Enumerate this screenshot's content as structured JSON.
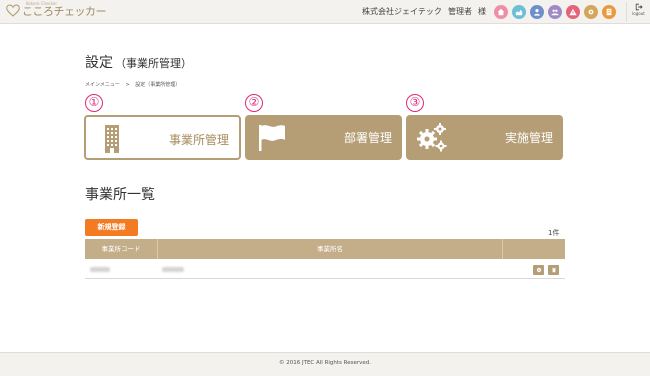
{
  "header": {
    "app_name": "こころチェッカー",
    "app_subtitle": "Kokoro Checker",
    "company": "株式会社ジェイテック",
    "user": "管理者",
    "honorific": "様",
    "nav_icons": [
      {
        "name": "home-icon",
        "color": "#ef8fa6"
      },
      {
        "name": "chart-icon",
        "color": "#6cbfd6"
      },
      {
        "name": "user-icon",
        "color": "#6e8fc9"
      },
      {
        "name": "group-icon",
        "color": "#a089c4"
      },
      {
        "name": "warning-icon",
        "color": "#e2637b"
      },
      {
        "name": "settings-icon",
        "color": "#d4a65a"
      },
      {
        "name": "document-icon",
        "color": "#e99a3f"
      }
    ],
    "logout_label": "logout"
  },
  "page": {
    "title": "設定",
    "title_sub": "（事業所管理）",
    "breadcrumb": [
      "メインメニュー",
      ">",
      "設定（事業所管理）"
    ]
  },
  "steps": [
    "①",
    "②",
    "③"
  ],
  "tiles": [
    {
      "label": "事業所管理",
      "icon": "building-icon",
      "active": true
    },
    {
      "label": "部署管理",
      "icon": "flag-icon",
      "active": false
    },
    {
      "label": "実施管理",
      "icon": "gears-icon",
      "active": false
    }
  ],
  "section": {
    "title": "事業所一覧",
    "new_button": "新規登録",
    "count": "1件"
  },
  "table": {
    "columns": [
      "事業所コード",
      "事業所名",
      ""
    ],
    "rows": [
      {
        "code": "",
        "name": ""
      }
    ]
  },
  "footer": {
    "copyright": "© 2016 JTEC All Rights Reserved."
  },
  "colors": {
    "brand": "#b59e76",
    "accent": "#f37b22",
    "step_marker": "#e0297a"
  }
}
